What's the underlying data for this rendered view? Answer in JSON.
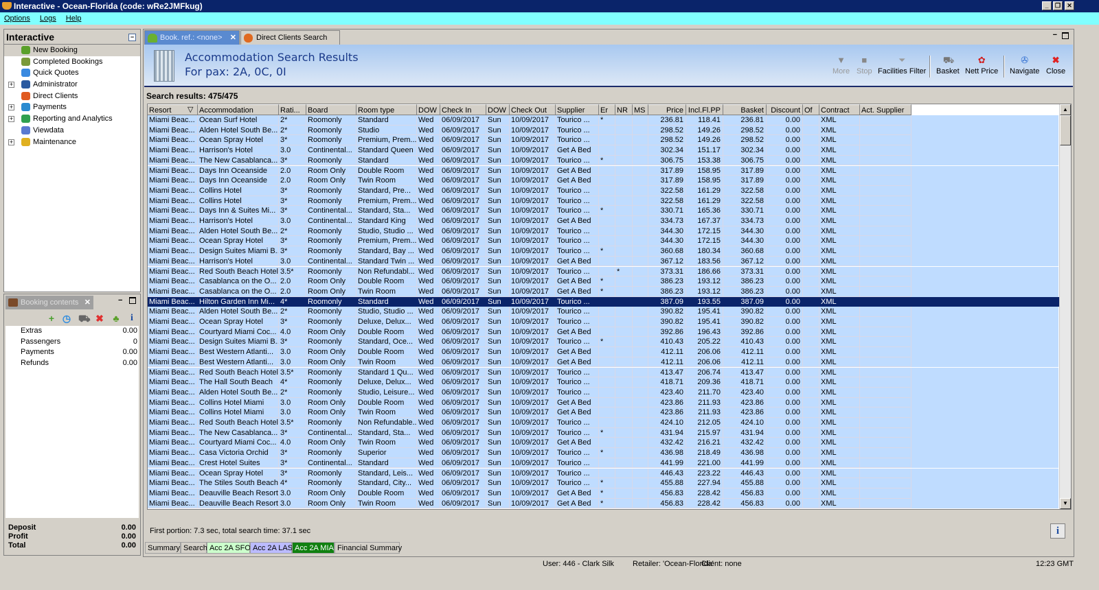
{
  "window": {
    "title": "Interactive - Ocean-Florida (code: wRe2JMFkug)"
  },
  "menu": [
    "Options",
    "Logs",
    "Help"
  ],
  "nav": {
    "title": "Interactive",
    "items": [
      {
        "label": "New Booking",
        "icon": "palm-tree-icon",
        "expandable": false,
        "color": "#5aa02a"
      },
      {
        "label": "Completed Bookings",
        "icon": "palm-money-icon",
        "expandable": false,
        "color": "#7a9a3a"
      },
      {
        "label": "Quick Quotes",
        "icon": "clock-icon",
        "expandable": false,
        "color": "#3a8ae0"
      },
      {
        "label": "Administrator",
        "icon": "running-man-icon",
        "expandable": true,
        "color": "#2a5aa0"
      },
      {
        "label": "Direct Clients",
        "icon": "client-icon",
        "expandable": false,
        "color": "#e05a20"
      },
      {
        "label": "Payments",
        "icon": "card-payment-icon",
        "expandable": true,
        "color": "#2a8ad0"
      },
      {
        "label": "Reporting and Analytics",
        "icon": "report-icon",
        "expandable": true,
        "color": "#30a050"
      },
      {
        "label": "Viewdata",
        "icon": "globe-icon",
        "expandable": false,
        "color": "#5a7ad0"
      },
      {
        "label": "Maintenance",
        "icon": "toolbox-icon",
        "expandable": true,
        "color": "#e0b020"
      }
    ]
  },
  "booking": {
    "title": "Booking contents",
    "toolbar_icons": [
      "add-icon",
      "refresh-clock-icon",
      "basket-go-icon",
      "delete-icon",
      "palm-tree-icon",
      "info-icon"
    ],
    "rows": [
      {
        "label": "Extras",
        "value": "0.00"
      },
      {
        "label": "Passengers",
        "value": "0"
      },
      {
        "label": "Payments",
        "value": "0.00"
      },
      {
        "label": "Refunds",
        "value": "0.00"
      }
    ],
    "totals": [
      {
        "label": "Deposit",
        "value": "0.00"
      },
      {
        "label": "Profit",
        "value": "0.00"
      },
      {
        "label": "Total",
        "value": "0.00"
      }
    ]
  },
  "tabs": [
    {
      "label": "Book. ref.: <none>",
      "active": true
    },
    {
      "label": "Direct Clients Search",
      "active": false
    }
  ],
  "header": {
    "title": "Accommodation Search Results",
    "subtitle": "For pax: 2A, 0C, 0I"
  },
  "toolbar": [
    {
      "label": "More",
      "icon": "triangle-down-icon",
      "enabled": false
    },
    {
      "label": "Stop",
      "icon": "stop-icon",
      "enabled": false
    },
    {
      "label": "Facilities Filter",
      "icon": "funnel-icon",
      "enabled": true
    },
    {
      "label": "Basket",
      "icon": "basket-icon",
      "enabled": true
    },
    {
      "label": "Nett Price",
      "icon": "nett-price-icon",
      "enabled": true
    },
    {
      "label": "Navigate",
      "icon": "compass-icon",
      "enabled": true
    },
    {
      "label": "Close",
      "icon": "close-icon",
      "enabled": true
    }
  ],
  "results": {
    "label": "Search results: 475/475",
    "columns": [
      "Resort",
      "Accommodation",
      "Rati...",
      "Board",
      "Room type",
      "DOW",
      "Check In",
      "DOW",
      "Check Out",
      "Supplier",
      "Er",
      "NR",
      "MS",
      "Price",
      "Incl.Fl.PP",
      "Basket",
      "Discount",
      "Of",
      "Contract",
      "Act. Supplier"
    ],
    "selected_index": 18,
    "rows": [
      [
        "Miami Beac...",
        "Ocean Surf Hotel",
        "2*",
        "Roomonly",
        "Standard",
        "Wed",
        "06/09/2017",
        "Sun",
        "10/09/2017",
        "Tourico ...",
        "*",
        "",
        "",
        "236.81",
        "118.41",
        "236.81",
        "0.00",
        "",
        "XML",
        ""
      ],
      [
        "Miami Beac...",
        "Alden Hotel South Be...",
        "2*",
        "Roomonly",
        "Studio",
        "Wed",
        "06/09/2017",
        "Sun",
        "10/09/2017",
        "Tourico ...",
        "",
        "",
        "",
        "298.52",
        "149.26",
        "298.52",
        "0.00",
        "",
        "XML",
        ""
      ],
      [
        "Miami Beac...",
        "Ocean Spray Hotel",
        "3*",
        "Roomonly",
        "Premium, Prem...",
        "Wed",
        "06/09/2017",
        "Sun",
        "10/09/2017",
        "Tourico ...",
        "",
        "",
        "",
        "298.52",
        "149.26",
        "298.52",
        "0.00",
        "",
        "XML",
        ""
      ],
      [
        "Miami Beac...",
        "Harrison's Hotel",
        "3.0",
        "Continental...",
        "Standard Queen",
        "Wed",
        "06/09/2017",
        "Sun",
        "10/09/2017",
        "Get A Bed",
        "",
        "",
        "",
        "302.34",
        "151.17",
        "302.34",
        "0.00",
        "",
        "XML",
        ""
      ],
      [
        "Miami Beac...",
        "The New Casablanca...",
        "3*",
        "Roomonly",
        "Standard",
        "Wed",
        "06/09/2017",
        "Sun",
        "10/09/2017",
        "Tourico ...",
        "*",
        "",
        "",
        "306.75",
        "153.38",
        "306.75",
        "0.00",
        "",
        "XML",
        ""
      ],
      [
        "Miami Beac...",
        "Days Inn Oceanside",
        "2.0",
        "Room Only",
        "Double Room",
        "Wed",
        "06/09/2017",
        "Sun",
        "10/09/2017",
        "Get A Bed",
        "",
        "",
        "",
        "317.89",
        "158.95",
        "317.89",
        "0.00",
        "",
        "XML",
        ""
      ],
      [
        "Miami Beac...",
        "Days Inn Oceanside",
        "2.0",
        "Room Only",
        "Twin Room",
        "Wed",
        "06/09/2017",
        "Sun",
        "10/09/2017",
        "Get A Bed",
        "",
        "",
        "",
        "317.89",
        "158.95",
        "317.89",
        "0.00",
        "",
        "XML",
        ""
      ],
      [
        "Miami Beac...",
        "Collins Hotel",
        "3*",
        "Roomonly",
        "Standard, Pre...",
        "Wed",
        "06/09/2017",
        "Sun",
        "10/09/2017",
        "Tourico ...",
        "",
        "",
        "",
        "322.58",
        "161.29",
        "322.58",
        "0.00",
        "",
        "XML",
        ""
      ],
      [
        "Miami Beac...",
        "Collins Hotel",
        "3*",
        "Roomonly",
        "Premium, Prem...",
        "Wed",
        "06/09/2017",
        "Sun",
        "10/09/2017",
        "Tourico ...",
        "",
        "",
        "",
        "322.58",
        "161.29",
        "322.58",
        "0.00",
        "",
        "XML",
        ""
      ],
      [
        "Miami Beac...",
        "Days Inn & Suites Mi...",
        "3*",
        "Continental...",
        "Standard, Sta...",
        "Wed",
        "06/09/2017",
        "Sun",
        "10/09/2017",
        "Tourico ...",
        "*",
        "",
        "",
        "330.71",
        "165.36",
        "330.71",
        "0.00",
        "",
        "XML",
        ""
      ],
      [
        "Miami Beac...",
        "Harrison's Hotel",
        "3.0",
        "Continental...",
        "Standard King",
        "Wed",
        "06/09/2017",
        "Sun",
        "10/09/2017",
        "Get A Bed",
        "",
        "",
        "",
        "334.73",
        "167.37",
        "334.73",
        "0.00",
        "",
        "XML",
        ""
      ],
      [
        "Miami Beac...",
        "Alden Hotel South Be...",
        "2*",
        "Roomonly",
        "Studio, Studio ...",
        "Wed",
        "06/09/2017",
        "Sun",
        "10/09/2017",
        "Tourico ...",
        "",
        "",
        "",
        "344.30",
        "172.15",
        "344.30",
        "0.00",
        "",
        "XML",
        ""
      ],
      [
        "Miami Beac...",
        "Ocean Spray Hotel",
        "3*",
        "Roomonly",
        "Premium, Prem...",
        "Wed",
        "06/09/2017",
        "Sun",
        "10/09/2017",
        "Tourico ...",
        "",
        "",
        "",
        "344.30",
        "172.15",
        "344.30",
        "0.00",
        "",
        "XML",
        ""
      ],
      [
        "Miami Beac...",
        "Design Suites Miami B...",
        "3*",
        "Roomonly",
        "Standard, Bay ...",
        "Wed",
        "06/09/2017",
        "Sun",
        "10/09/2017",
        "Tourico ...",
        "*",
        "",
        "",
        "360.68",
        "180.34",
        "360.68",
        "0.00",
        "",
        "XML",
        ""
      ],
      [
        "Miami Beac...",
        "Harrison's Hotel",
        "3.0",
        "Continental...",
        "Standard Twin ...",
        "Wed",
        "06/09/2017",
        "Sun",
        "10/09/2017",
        "Get A Bed",
        "",
        "",
        "",
        "367.12",
        "183.56",
        "367.12",
        "0.00",
        "",
        "XML",
        ""
      ],
      [
        "Miami Beac...",
        "Red South Beach Hotel",
        "3.5*",
        "Roomonly",
        "Non Refundabl...",
        "Wed",
        "06/09/2017",
        "Sun",
        "10/09/2017",
        "Tourico ...",
        "",
        "*",
        "",
        "373.31",
        "186.66",
        "373.31",
        "0.00",
        "",
        "XML",
        ""
      ],
      [
        "Miami Beac...",
        "Casablanca on the O...",
        "2.0",
        "Room Only",
        "Double Room",
        "Wed",
        "06/09/2017",
        "Sun",
        "10/09/2017",
        "Get A Bed",
        "*",
        "",
        "",
        "386.23",
        "193.12",
        "386.23",
        "0.00",
        "",
        "XML",
        ""
      ],
      [
        "Miami Beac...",
        "Casablanca on the O...",
        "2.0",
        "Room Only",
        "Twin Room",
        "Wed",
        "06/09/2017",
        "Sun",
        "10/09/2017",
        "Get A Bed",
        "*",
        "",
        "",
        "386.23",
        "193.12",
        "386.23",
        "0.00",
        "",
        "XML",
        ""
      ],
      [
        "Miami Beac...",
        "Hilton Garden Inn Mi...",
        "4*",
        "Roomonly",
        "Standard",
        "Wed",
        "06/09/2017",
        "Sun",
        "10/09/2017",
        "Tourico ...",
        "",
        "",
        "",
        "387.09",
        "193.55",
        "387.09",
        "0.00",
        "",
        "XML",
        ""
      ],
      [
        "Miami Beac...",
        "Alden Hotel South Be...",
        "2*",
        "Roomonly",
        "Studio, Studio ...",
        "Wed",
        "06/09/2017",
        "Sun",
        "10/09/2017",
        "Tourico ...",
        "",
        "",
        "",
        "390.82",
        "195.41",
        "390.82",
        "0.00",
        "",
        "XML",
        ""
      ],
      [
        "Miami Beac...",
        "Ocean Spray Hotel",
        "3*",
        "Roomonly",
        "Deluxe, Delux...",
        "Wed",
        "06/09/2017",
        "Sun",
        "10/09/2017",
        "Tourico ...",
        "",
        "",
        "",
        "390.82",
        "195.41",
        "390.82",
        "0.00",
        "",
        "XML",
        ""
      ],
      [
        "Miami Beac...",
        "Courtyard Miami Coc...",
        "4.0",
        "Room Only",
        "Double Room",
        "Wed",
        "06/09/2017",
        "Sun",
        "10/09/2017",
        "Get A Bed",
        "",
        "",
        "",
        "392.86",
        "196.43",
        "392.86",
        "0.00",
        "",
        "XML",
        ""
      ],
      [
        "Miami Beac...",
        "Design Suites Miami B...",
        "3*",
        "Roomonly",
        "Standard, Oce...",
        "Wed",
        "06/09/2017",
        "Sun",
        "10/09/2017",
        "Tourico ...",
        "*",
        "",
        "",
        "410.43",
        "205.22",
        "410.43",
        "0.00",
        "",
        "XML",
        ""
      ],
      [
        "Miami Beac...",
        "Best Western Atlanti...",
        "3.0",
        "Room Only",
        "Double Room",
        "Wed",
        "06/09/2017",
        "Sun",
        "10/09/2017",
        "Get A Bed",
        "",
        "",
        "",
        "412.11",
        "206.06",
        "412.11",
        "0.00",
        "",
        "XML",
        ""
      ],
      [
        "Miami Beac...",
        "Best Western Atlanti...",
        "3.0",
        "Room Only",
        "Twin Room",
        "Wed",
        "06/09/2017",
        "Sun",
        "10/09/2017",
        "Get A Bed",
        "",
        "",
        "",
        "412.11",
        "206.06",
        "412.11",
        "0.00",
        "",
        "XML",
        ""
      ],
      [
        "Miami Beac...",
        "Red South Beach Hotel",
        "3.5*",
        "Roomonly",
        "Standard 1 Qu...",
        "Wed",
        "06/09/2017",
        "Sun",
        "10/09/2017",
        "Tourico ...",
        "",
        "",
        "",
        "413.47",
        "206.74",
        "413.47",
        "0.00",
        "",
        "XML",
        ""
      ],
      [
        "Miami Beac...",
        "The Hall South Beach",
        "4*",
        "Roomonly",
        "Deluxe, Delux...",
        "Wed",
        "06/09/2017",
        "Sun",
        "10/09/2017",
        "Tourico ...",
        "",
        "",
        "",
        "418.71",
        "209.36",
        "418.71",
        "0.00",
        "",
        "XML",
        ""
      ],
      [
        "Miami Beac...",
        "Alden Hotel South Be...",
        "2*",
        "Roomonly",
        "Studio, Leisure...",
        "Wed",
        "06/09/2017",
        "Sun",
        "10/09/2017",
        "Tourico ...",
        "",
        "",
        "",
        "423.40",
        "211.70",
        "423.40",
        "0.00",
        "",
        "XML",
        ""
      ],
      [
        "Miami Beac...",
        "Collins Hotel Miami",
        "3.0",
        "Room Only",
        "Double Room",
        "Wed",
        "06/09/2017",
        "Sun",
        "10/09/2017",
        "Get A Bed",
        "",
        "",
        "",
        "423.86",
        "211.93",
        "423.86",
        "0.00",
        "",
        "XML",
        ""
      ],
      [
        "Miami Beac...",
        "Collins Hotel Miami",
        "3.0",
        "Room Only",
        "Twin Room",
        "Wed",
        "06/09/2017",
        "Sun",
        "10/09/2017",
        "Get A Bed",
        "",
        "",
        "",
        "423.86",
        "211.93",
        "423.86",
        "0.00",
        "",
        "XML",
        ""
      ],
      [
        "Miami Beac...",
        "Red South Beach Hotel",
        "3.5*",
        "Roomonly",
        "Non Refundable...",
        "Wed",
        "06/09/2017",
        "Sun",
        "10/09/2017",
        "Tourico ...",
        "",
        "",
        "",
        "424.10",
        "212.05",
        "424.10",
        "0.00",
        "",
        "XML",
        ""
      ],
      [
        "Miami Beac...",
        "The New Casablanca...",
        "3*",
        "Continental...",
        "Standard, Sta...",
        "Wed",
        "06/09/2017",
        "Sun",
        "10/09/2017",
        "Tourico ...",
        "*",
        "",
        "",
        "431.94",
        "215.97",
        "431.94",
        "0.00",
        "",
        "XML",
        ""
      ],
      [
        "Miami Beac...",
        "Courtyard Miami Coc...",
        "4.0",
        "Room Only",
        "Twin Room",
        "Wed",
        "06/09/2017",
        "Sun",
        "10/09/2017",
        "Get A Bed",
        "",
        "",
        "",
        "432.42",
        "216.21",
        "432.42",
        "0.00",
        "",
        "XML",
        ""
      ],
      [
        "Miami Beac...",
        "Casa Victoria Orchid",
        "3*",
        "Roomonly",
        "Superior",
        "Wed",
        "06/09/2017",
        "Sun",
        "10/09/2017",
        "Tourico ...",
        "*",
        "",
        "",
        "436.98",
        "218.49",
        "436.98",
        "0.00",
        "",
        "XML",
        ""
      ],
      [
        "Miami Beac...",
        "Crest Hotel Suites",
        "3*",
        "Continental...",
        "Standard",
        "Wed",
        "06/09/2017",
        "Sun",
        "10/09/2017",
        "Tourico ...",
        "",
        "",
        "",
        "441.99",
        "221.00",
        "441.99",
        "0.00",
        "",
        "XML",
        ""
      ],
      [
        "Miami Beac...",
        "Ocean Spray Hotel",
        "3*",
        "Roomonly",
        "Standard, Leis...",
        "Wed",
        "06/09/2017",
        "Sun",
        "10/09/2017",
        "Tourico ...",
        "",
        "",
        "",
        "446.43",
        "223.22",
        "446.43",
        "0.00",
        "",
        "XML",
        ""
      ],
      [
        "Miami Beac...",
        "The Stiles South Beach",
        "4*",
        "Roomonly",
        "Standard, City...",
        "Wed",
        "06/09/2017",
        "Sun",
        "10/09/2017",
        "Tourico ...",
        "*",
        "",
        "",
        "455.88",
        "227.94",
        "455.88",
        "0.00",
        "",
        "XML",
        ""
      ],
      [
        "Miami Beac...",
        "Deauville Beach Resort",
        "3.0",
        "Room Only",
        "Double Room",
        "Wed",
        "06/09/2017",
        "Sun",
        "10/09/2017",
        "Get A Bed",
        "*",
        "",
        "",
        "456.83",
        "228.42",
        "456.83",
        "0.00",
        "",
        "XML",
        ""
      ],
      [
        "Miami Beac...",
        "Deauville Beach Resort",
        "3.0",
        "Room Only",
        "Twin Room",
        "Wed",
        "06/09/2017",
        "Sun",
        "10/09/2017",
        "Get A Bed",
        "*",
        "",
        "",
        "456.83",
        "228.42",
        "456.83",
        "0.00",
        "",
        "XML",
        ""
      ]
    ]
  },
  "timing": "First portion: 7.3 sec, total search time: 37.1 sec",
  "bottom_tabs": [
    {
      "label": "Summary",
      "color": "#d4d0c8",
      "text": "#000"
    },
    {
      "label": "Search",
      "color": "#d4d0c8",
      "text": "#000"
    },
    {
      "label": "Acc 2A SFO",
      "color": "#ccffcc",
      "text": "#000"
    },
    {
      "label": "Acc 2A LAS",
      "color": "#bbbbff",
      "text": "#000"
    },
    {
      "label": "Acc 2A MIA",
      "color": "#108010",
      "text": "#fff"
    },
    {
      "label": "Financial Summary",
      "color": "#d4d0c8",
      "text": "#000"
    }
  ],
  "status": {
    "user": "User: 446 - Clark Silk",
    "retailer": "Retailer: 'Ocean-Florida'",
    "client": "Client: none",
    "time": "12:23 GMT"
  },
  "colors": {
    "row": "#bfdcff",
    "selected_row": "#0a246a",
    "title_bar": "#0a246a",
    "menu_bar": "#80ffff"
  }
}
